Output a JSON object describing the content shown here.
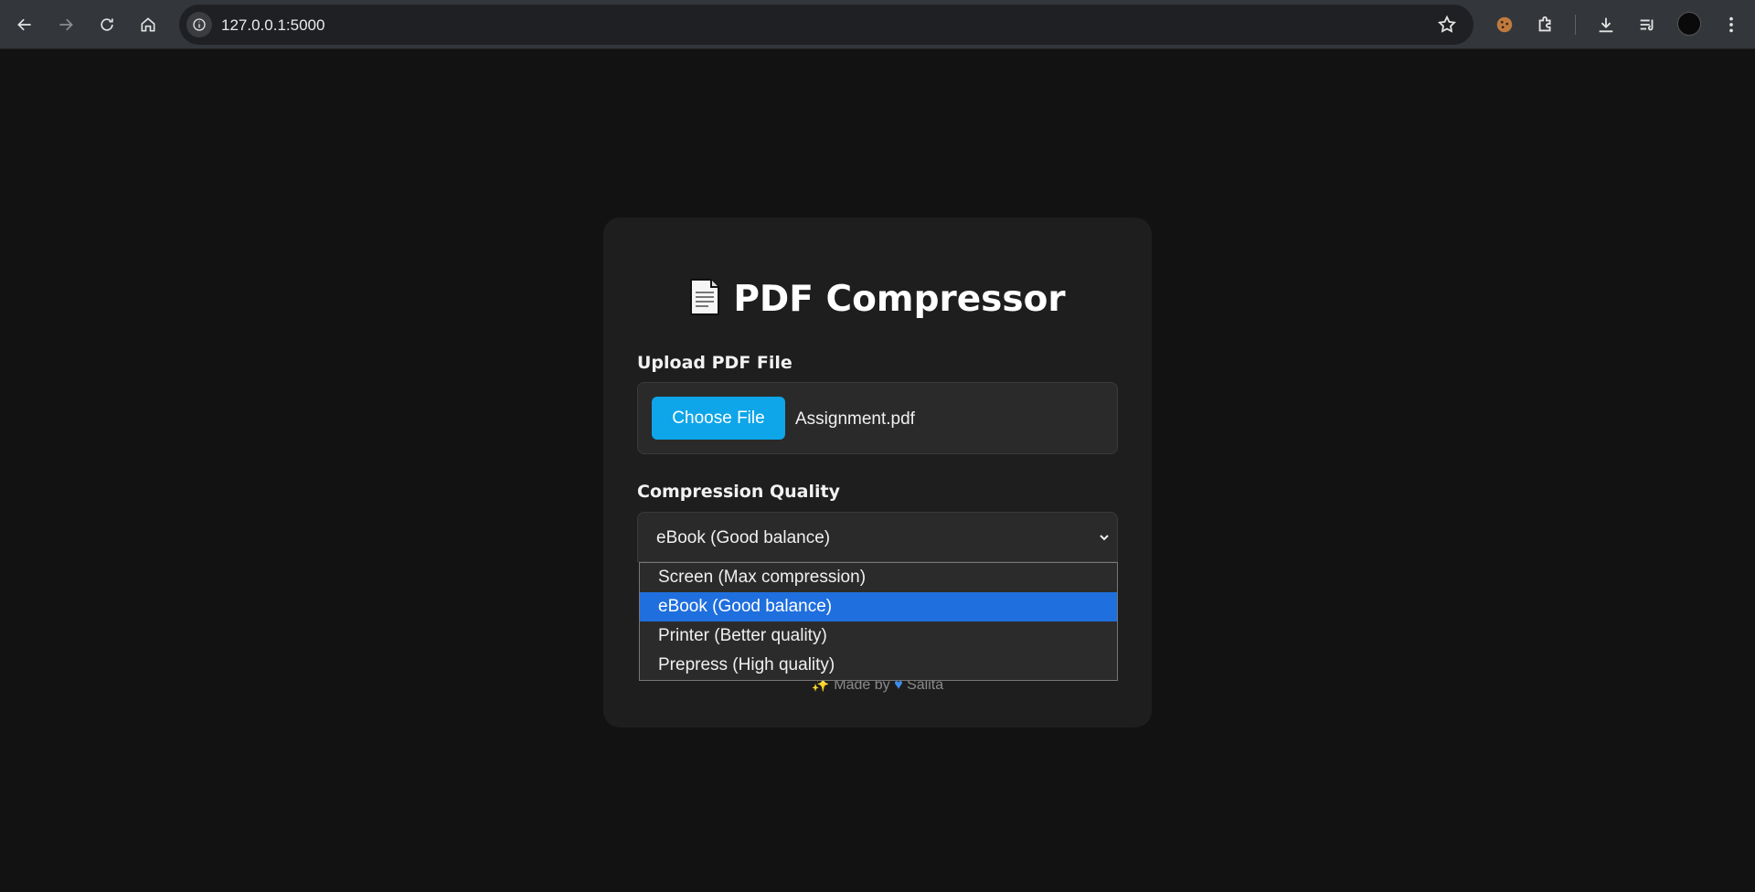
{
  "browser": {
    "url": "127.0.0.1:5000",
    "back_icon": "arrow-left-icon",
    "forward_icon": "arrow-right-icon",
    "reload_icon": "reload-icon",
    "home_icon": "home-icon"
  },
  "card": {
    "title": "PDF Compressor",
    "title_icon": "document-icon",
    "upload_label": "Upload PDF File",
    "choose_file_label": "Choose File",
    "file_name": "Assignment.pdf",
    "quality_label": "Compression Quality",
    "quality_selected": "eBook (Good balance)",
    "footer_prefix": "Made by",
    "footer_name": "Salita"
  },
  "dropdown": {
    "options": [
      "Screen (Max compression)",
      "eBook (Good balance)",
      "Printer (Better quality)",
      "Prepress (High quality)"
    ],
    "selected_index": 1
  },
  "colors": {
    "accent": "#0ea5e9",
    "selection": "#1f6fde",
    "background": "#121212",
    "card": "#1e1e1e"
  }
}
